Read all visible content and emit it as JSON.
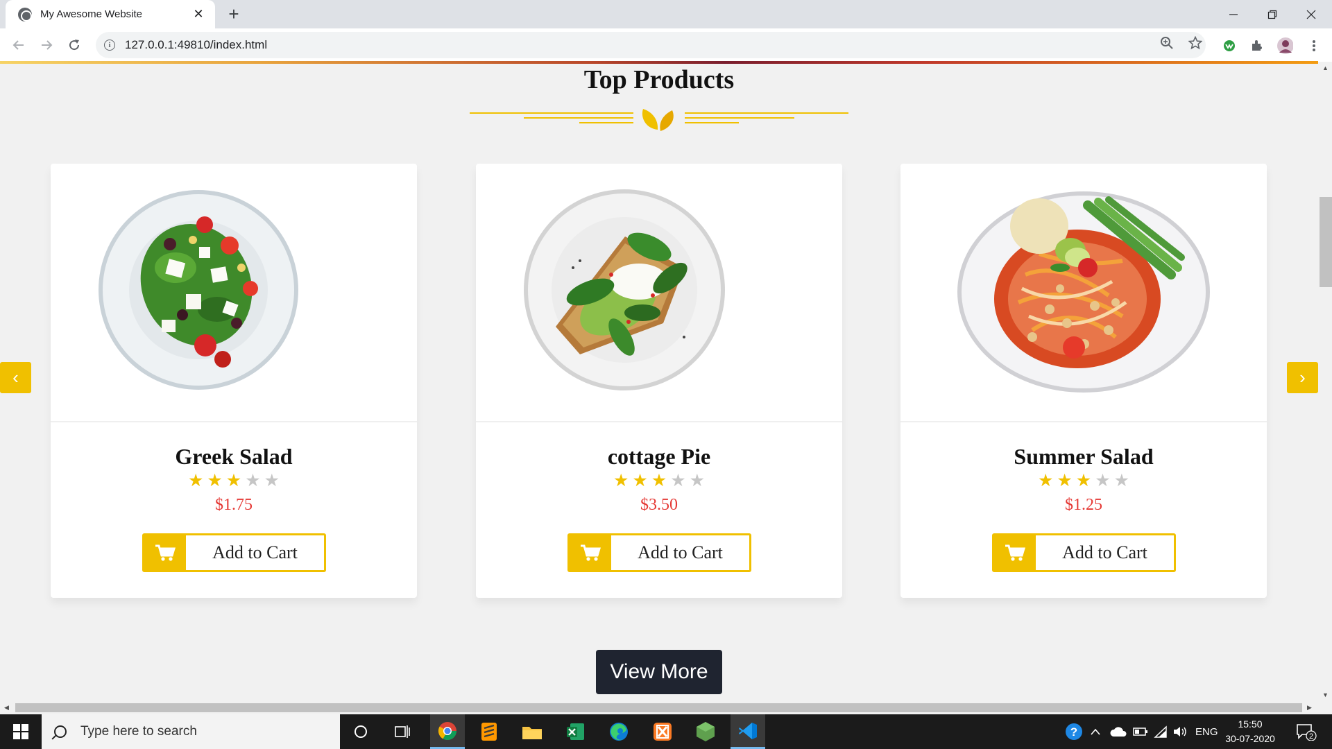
{
  "browser": {
    "tab_title": "My Awesome Website",
    "tab_close": "✕",
    "new_tab": "+",
    "url": "127.0.0.1:49810/index.html"
  },
  "page": {
    "section_title": "Top Products",
    "prev_arrow": "‹",
    "next_arrow": "›",
    "view_more": "View More",
    "products": [
      {
        "name": "Greek Salad",
        "rating": 3,
        "max_rating": 5,
        "price": "$1.75",
        "cart_label": "Add to Cart"
      },
      {
        "name": "cottage Pie",
        "rating": 3,
        "max_rating": 5,
        "price": "$3.50",
        "cart_label": "Add to Cart"
      },
      {
        "name": "Summer Salad",
        "rating": 3,
        "max_rating": 5,
        "price": "$1.25",
        "cart_label": "Add to Cart"
      }
    ]
  },
  "taskbar": {
    "search_placeholder": "Type here to search",
    "language": "ENG",
    "time": "15:50",
    "date": "30-07-2020",
    "notifications": "2"
  },
  "colors": {
    "accent": "#f0c000",
    "price": "#e53935",
    "button_dark": "#1f2430"
  }
}
